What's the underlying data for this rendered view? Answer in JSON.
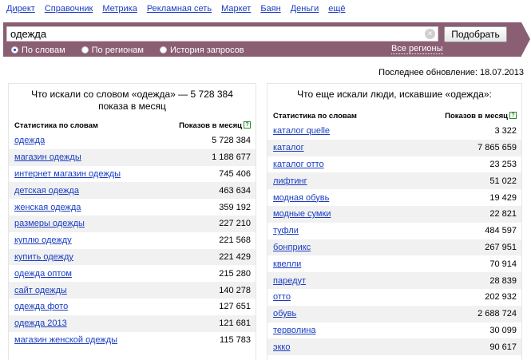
{
  "nav": [
    "Директ",
    "Справочник",
    "Метрика",
    "Рекламная сеть",
    "Маркет",
    "Баян",
    "Деньги",
    "ещё"
  ],
  "search": {
    "value": "одежда",
    "button_label": "Подобрать"
  },
  "modes": [
    {
      "label": "По словам",
      "active": true
    },
    {
      "label": "По регионам",
      "active": false
    },
    {
      "label": "История запросов",
      "active": false
    }
  ],
  "regions_label": "Все регионы",
  "updated": "Последнее обновление: 18.07.2013",
  "left": {
    "title": "Что искали со словом «одежда» — 5 728 384 показа в месяц",
    "col_words": "Статистика по словам",
    "col_count": "Показов в месяц",
    "rows": [
      {
        "phrase": "одежда",
        "count": "5 728 384"
      },
      {
        "phrase": "магазин одежды",
        "count": "1 188 677"
      },
      {
        "phrase": "интернет магазин одежды",
        "count": "745 406"
      },
      {
        "phrase": "детская одежда",
        "count": "463 634"
      },
      {
        "phrase": "женская одежда",
        "count": "359 192"
      },
      {
        "phrase": "размеры одежды",
        "count": "227 210"
      },
      {
        "phrase": "куплю одежду",
        "count": "221 568"
      },
      {
        "phrase": "купить одежду",
        "count": "221 429"
      },
      {
        "phrase": "одежда оптом",
        "count": "215 280"
      },
      {
        "phrase": "сайт одежды",
        "count": "140 278"
      },
      {
        "phrase": "одежда фото",
        "count": "127 651"
      },
      {
        "phrase": "одежда 2013",
        "count": "121 681"
      },
      {
        "phrase": "магазин женской одежды",
        "count": "115 783"
      }
    ]
  },
  "right": {
    "title": "Что еще искали люди, искавшие «одежда»:",
    "col_words": "Статистика по словам",
    "col_count": "Показов в месяц",
    "rows": [
      {
        "phrase": "каталог quelle",
        "count": "3 322"
      },
      {
        "phrase": "каталог",
        "count": "7 865 659"
      },
      {
        "phrase": "каталог отто",
        "count": "23 253"
      },
      {
        "phrase": "лифтинг",
        "count": "51 022"
      },
      {
        "phrase": "модная обувь",
        "count": "19 429"
      },
      {
        "phrase": "модные сумки",
        "count": "22 821"
      },
      {
        "phrase": "туфли",
        "count": "484 597"
      },
      {
        "phrase": "бонприкс",
        "count": "267 951"
      },
      {
        "phrase": "квелли",
        "count": "70 914"
      },
      {
        "phrase": "паредут",
        "count": "28 839"
      },
      {
        "phrase": "отто",
        "count": "202 932"
      },
      {
        "phrase": "обувь",
        "count": "2 688 724"
      },
      {
        "phrase": "терволина",
        "count": "30 099"
      },
      {
        "phrase": "экко",
        "count": "90 617"
      }
    ]
  }
}
